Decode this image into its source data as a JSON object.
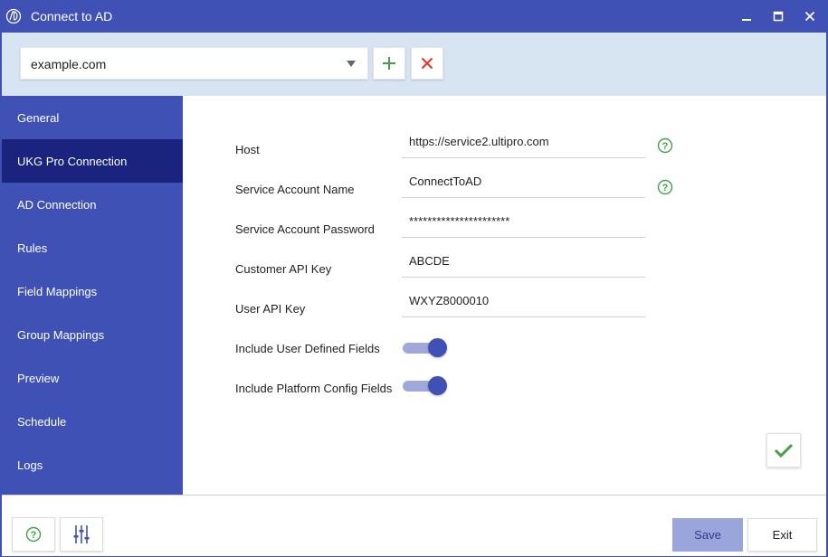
{
  "window": {
    "title": "Connect to AD",
    "controls": {
      "minimize": "minimize-icon",
      "maximize": "maximize-icon",
      "close": "close-icon"
    }
  },
  "domain_bar": {
    "selected_domain": "example.com",
    "add_icon": "plus-icon",
    "remove_icon": "x-icon"
  },
  "sidebar": {
    "active_index": 1,
    "items": [
      {
        "label": "General"
      },
      {
        "label": "UKG Pro Connection"
      },
      {
        "label": "AD Connection"
      },
      {
        "label": "Rules"
      },
      {
        "label": "Field Mappings"
      },
      {
        "label": "Group Mappings"
      },
      {
        "label": "Preview"
      },
      {
        "label": "Schedule"
      },
      {
        "label": "Logs"
      }
    ]
  },
  "form": {
    "host": {
      "label": "Host",
      "value": "https://service2.ultipro.com"
    },
    "service_account_name": {
      "label": "Service Account Name",
      "value": "ConnectToAD"
    },
    "service_account_password": {
      "label": "Service Account Password",
      "value": "**********************"
    },
    "customer_api_key": {
      "label": "Customer API Key",
      "value": "ABCDE"
    },
    "user_api_key": {
      "label": "User API Key",
      "value": "WXYZ8000010"
    },
    "include_user_defined_fields": {
      "label": "Include User Defined Fields",
      "enabled": true
    },
    "include_platform_config_fields": {
      "label": "Include Platform Config Fields",
      "enabled": true
    }
  },
  "footer": {
    "save_label": "Save",
    "exit_label": "Exit"
  },
  "colors": {
    "primary": "#3f51b5",
    "sidebar_active": "#1a237e",
    "header_band": "#d7e4f2",
    "add_green": "#43a047",
    "remove_red": "#e53935",
    "save_button": "#9aa5db"
  }
}
